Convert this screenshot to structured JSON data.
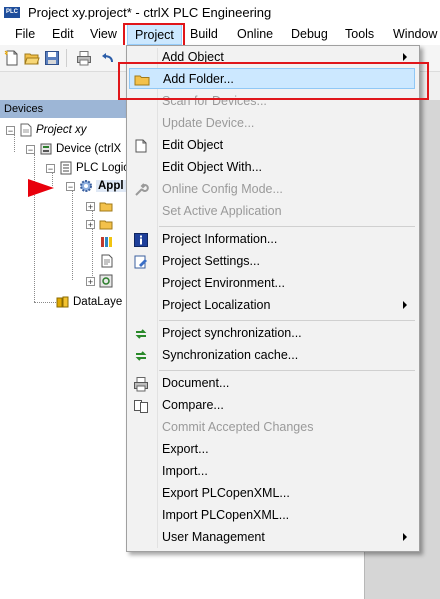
{
  "window": {
    "title": "Project xy.project* - ctrlX PLC Engineering",
    "logo_text": "PLC"
  },
  "menubar": {
    "items": [
      "File",
      "Edit",
      "View",
      "Project",
      "Build",
      "Online",
      "Debug",
      "Tools",
      "Window"
    ],
    "active": "Project"
  },
  "devices_panel": {
    "title": "Devices",
    "tree": {
      "project": "Project xy",
      "device": "Device (ctrlX",
      "plc_logic": "PLC Logic",
      "application": "Appl",
      "datalayer": "DataLaye"
    }
  },
  "project_menu": {
    "items": [
      {
        "label": "Add Object",
        "enabled": true,
        "submenu": true,
        "icon": "none"
      },
      {
        "label": "Add Folder...",
        "enabled": true,
        "submenu": false,
        "icon": "folder-icon",
        "highlighted": true
      },
      {
        "label": "Scan for Devices...",
        "enabled": false,
        "submenu": false,
        "icon": "none"
      },
      {
        "label": "Update Device...",
        "enabled": false,
        "submenu": false,
        "icon": "none"
      },
      {
        "label": "Edit Object",
        "enabled": true,
        "submenu": false,
        "icon": "edit-object-icon"
      },
      {
        "label": "Edit Object With...",
        "enabled": true,
        "submenu": false,
        "icon": "none"
      },
      {
        "label": "Online Config Mode...",
        "enabled": false,
        "submenu": false,
        "icon": "wrench-icon"
      },
      {
        "label": "Set Active Application",
        "enabled": false,
        "submenu": false,
        "icon": "none"
      },
      {
        "label": "Project Information...",
        "enabled": true,
        "submenu": false,
        "icon": "info-icon"
      },
      {
        "label": "Project Settings...",
        "enabled": true,
        "submenu": false,
        "icon": "settings-icon"
      },
      {
        "label": "Project Environment...",
        "enabled": true,
        "submenu": false,
        "icon": "none"
      },
      {
        "label": "Project Localization",
        "enabled": true,
        "submenu": true,
        "icon": "none"
      },
      {
        "label": "Project synchronization...",
        "enabled": true,
        "submenu": false,
        "icon": "sync-icon"
      },
      {
        "label": "Synchronization cache...",
        "enabled": true,
        "submenu": false,
        "icon": "sync-icon"
      },
      {
        "label": "Document...",
        "enabled": true,
        "submenu": false,
        "icon": "printer-icon"
      },
      {
        "label": "Compare...",
        "enabled": true,
        "submenu": false,
        "icon": "compare-icon"
      },
      {
        "label": "Commit Accepted Changes",
        "enabled": false,
        "submenu": false,
        "icon": "none"
      },
      {
        "label": "Export...",
        "enabled": true,
        "submenu": false,
        "icon": "none"
      },
      {
        "label": "Import...",
        "enabled": true,
        "submenu": false,
        "icon": "none"
      },
      {
        "label": "Export PLCopenXML...",
        "enabled": true,
        "submenu": false,
        "icon": "none"
      },
      {
        "label": "Import PLCopenXML...",
        "enabled": true,
        "submenu": false,
        "icon": "none"
      },
      {
        "label": "User Management",
        "enabled": true,
        "submenu": true,
        "icon": "none"
      }
    ]
  },
  "colors": {
    "annotation_red": "#e0161a",
    "highlight": "#cce8ff",
    "panel_header": "#9db6d6"
  }
}
